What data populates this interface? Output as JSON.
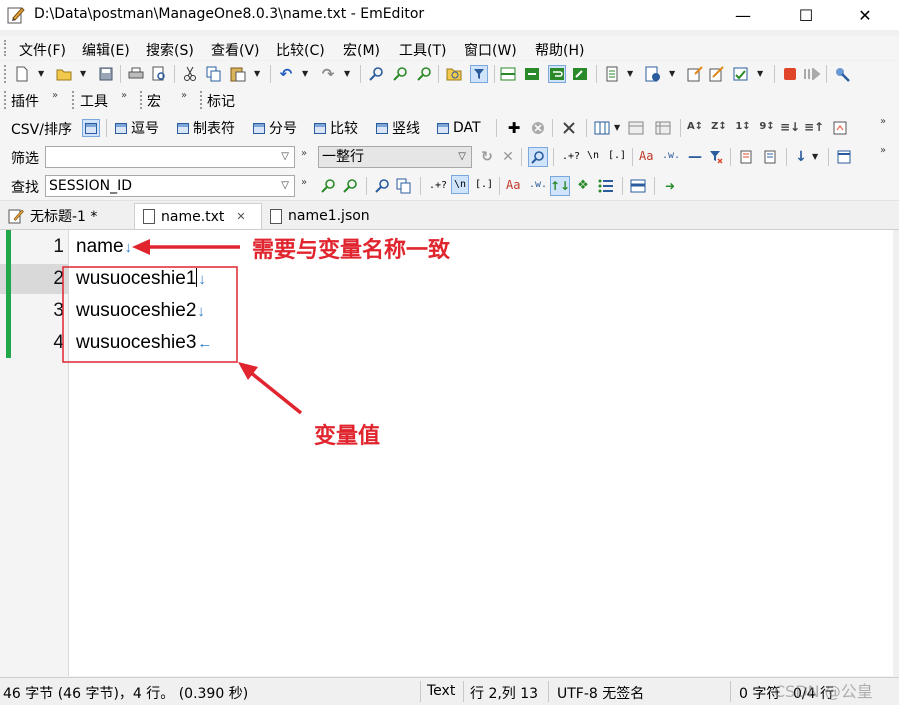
{
  "window": {
    "title": "D:\\Data\\postman\\ManageOne8.0.3\\name.txt - EmEditor",
    "minimize_glyph": "—",
    "maximize_glyph": "☐",
    "close_glyph": "✕"
  },
  "menu": [
    "文件(F)",
    "编辑(E)",
    "搜索(S)",
    "查看(V)",
    "比较(C)",
    "宏(M)",
    "工具(T)",
    "窗口(W)",
    "帮助(H)"
  ],
  "toolbar_labels": {
    "plugins": "插件",
    "tools": "工具",
    "macros": "宏",
    "markers": "标记",
    "csv_sort": "CSV/排序",
    "overflow": "»"
  },
  "csv_buttons": [
    "逗号",
    "制表符",
    "分号",
    "比较",
    "竖线",
    "DAT"
  ],
  "filter": {
    "label": "筛选",
    "value": "",
    "mode_value": "一整行",
    "regex": ".+?",
    "newline": "\\n",
    "bracket": "[.]",
    "case": "Aa",
    "word": ".w."
  },
  "find": {
    "label": "查找",
    "value": "SESSION_ID",
    "regex": ".+?",
    "newline": "\\n",
    "bracket": "[.]",
    "case": "Aa",
    "word": ".w."
  },
  "tabs": [
    {
      "label": "无标题-1 *"
    },
    {
      "label": "name.txt",
      "close": "✕"
    },
    {
      "label": "name1.json"
    }
  ],
  "editor": {
    "lines": [
      {
        "number": "1",
        "text": "name"
      },
      {
        "number": "2",
        "text": "wusuoceshie1"
      },
      {
        "number": "3",
        "text": "wusuoceshie2"
      },
      {
        "number": "4",
        "text": "wusuoceshie3"
      }
    ],
    "eol_crlf": "↓",
    "eol_eof": "←"
  },
  "annotations": {
    "header_note": "需要与变量名称一致",
    "values_note": "变量值",
    "color": "#e0252f"
  },
  "status": {
    "stats": "46 字节 (46 字节)，4 行。 (0.390 秒)",
    "mode": "Text",
    "position": "行 2,列 13",
    "encoding": "UTF-8 无签名",
    "selection_chars": "0 字符",
    "selection_lines": "0/4 行",
    "watermark": "CSDN @公皇"
  },
  "colors": {
    "accent_green": "#22a84a",
    "eol_blue": "#2b7bc8"
  }
}
